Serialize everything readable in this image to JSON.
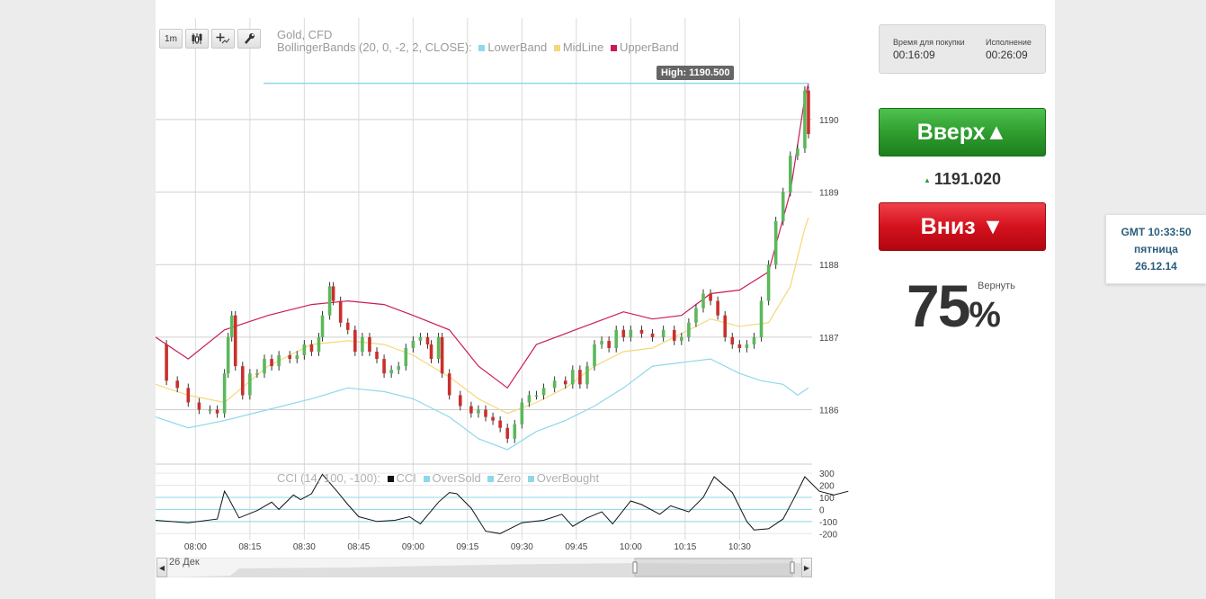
{
  "toolbar": {
    "interval_label": "1m",
    "buttons": [
      "candles-icon",
      "crosshair-icon",
      "wrench-icon"
    ]
  },
  "chart": {
    "instrument": "Gold, CFD",
    "indicator": "BollingerBands (20, 0, -2, 2, CLOSE):",
    "legend": [
      {
        "name": "LowerBand",
        "color": "#8fd8ea"
      },
      {
        "name": "MidLine",
        "color": "#f5d77a"
      },
      {
        "name": "UpperBand",
        "color": "#cc1a55"
      }
    ],
    "high_label": "High: 1190.500",
    "cci_title": "CCI (14, 100, -100):",
    "cci_legend": [
      {
        "name": "CCI",
        "color": "#111111"
      },
      {
        "name": "OverSold",
        "color": "#8fd8ea"
      },
      {
        "name": "Zero",
        "color": "#8fd8ea"
      },
      {
        "name": "OverBought",
        "color": "#8fd8ea"
      }
    ],
    "nav_date": "26 Дек"
  },
  "chart_data": {
    "type": "candlestick",
    "y_ticks": [
      "1190",
      "1189",
      "1188",
      "1187",
      "1186"
    ],
    "y_values": [
      1190,
      1189,
      1188,
      1187,
      1186
    ],
    "ylim": [
      1185.3,
      1191.4
    ],
    "x_ticks": [
      "08:00",
      "08:15",
      "08:30",
      "08:45",
      "09:00",
      "09:15",
      "09:30",
      "09:45",
      "10:00",
      "10:15",
      "10:30"
    ],
    "x_tick_minutes": [
      480,
      495,
      510,
      525,
      540,
      555,
      570,
      585,
      600,
      615,
      630
    ],
    "xlim_minutes": [
      469,
      650
    ],
    "close_series": [
      [
        469,
        1186.9
      ],
      [
        472,
        1186.4
      ],
      [
        475,
        1186.3
      ],
      [
        478,
        1186.1
      ],
      [
        481,
        1186.0
      ],
      [
        484,
        1186.0
      ],
      [
        486,
        1185.95
      ],
      [
        488,
        1186.5
      ],
      [
        489,
        1187.0
      ],
      [
        490,
        1187.3
      ],
      [
        491,
        1186.6
      ],
      [
        493,
        1186.2
      ],
      [
        495,
        1186.5
      ],
      [
        497,
        1186.5
      ],
      [
        499,
        1186.7
      ],
      [
        501,
        1186.6
      ],
      [
        503,
        1186.75
      ],
      [
        506,
        1186.7
      ],
      [
        508,
        1186.75
      ],
      [
        510,
        1186.9
      ],
      [
        512,
        1186.8
      ],
      [
        514,
        1187.0
      ],
      [
        515,
        1187.3
      ],
      [
        517,
        1187.7
      ],
      [
        518,
        1187.5
      ],
      [
        520,
        1187.2
      ],
      [
        522,
        1187.1
      ],
      [
        524,
        1186.8
      ],
      [
        526,
        1187.0
      ],
      [
        528,
        1186.8
      ],
      [
        530,
        1186.7
      ],
      [
        532,
        1186.5
      ],
      [
        534,
        1186.55
      ],
      [
        536,
        1186.6
      ],
      [
        538,
        1186.85
      ],
      [
        540,
        1186.95
      ],
      [
        542,
        1187.0
      ],
      [
        544,
        1186.9
      ],
      [
        545,
        1186.7
      ],
      [
        547,
        1187.0
      ],
      [
        548,
        1186.5
      ],
      [
        550,
        1186.2
      ],
      [
        553,
        1186.05
      ],
      [
        556,
        1185.95
      ],
      [
        558,
        1186.0
      ],
      [
        560,
        1185.9
      ],
      [
        562,
        1185.85
      ],
      [
        564,
        1185.75
      ],
      [
        566,
        1185.6
      ],
      [
        568,
        1185.8
      ],
      [
        570,
        1186.1
      ],
      [
        572,
        1186.2
      ],
      [
        574,
        1186.2
      ],
      [
        576,
        1186.3
      ],
      [
        579,
        1186.4
      ],
      [
        582,
        1186.35
      ],
      [
        584,
        1186.55
      ],
      [
        586,
        1186.35
      ],
      [
        588,
        1186.6
      ],
      [
        590,
        1186.9
      ],
      [
        592,
        1186.95
      ],
      [
        594,
        1186.85
      ],
      [
        596,
        1187.1
      ],
      [
        598,
        1187.0
      ],
      [
        600,
        1187.1
      ],
      [
        603,
        1187.05
      ],
      [
        606,
        1187.0
      ],
      [
        609,
        1187.1
      ],
      [
        612,
        1186.95
      ],
      [
        614,
        1187.0
      ],
      [
        616,
        1187.2
      ],
      [
        618,
        1187.4
      ],
      [
        620,
        1187.6
      ],
      [
        622,
        1187.5
      ],
      [
        624,
        1187.3
      ],
      [
        626,
        1187.0
      ],
      [
        628,
        1186.9
      ],
      [
        630,
        1186.85
      ],
      [
        632,
        1186.9
      ],
      [
        634,
        1187.0
      ],
      [
        636,
        1187.5
      ],
      [
        638,
        1188.0
      ],
      [
        640,
        1188.6
      ],
      [
        642,
        1189.0
      ],
      [
        644,
        1189.5
      ],
      [
        646,
        1189.6
      ],
      [
        648,
        1190.4
      ],
      [
        649,
        1189.8
      ]
    ],
    "high": 1190.5,
    "upper_band": [
      [
        469,
        1187.0
      ],
      [
        478,
        1186.7
      ],
      [
        488,
        1187.1
      ],
      [
        500,
        1187.3
      ],
      [
        512,
        1187.45
      ],
      [
        522,
        1187.5
      ],
      [
        532,
        1187.45
      ],
      [
        540,
        1187.3
      ],
      [
        550,
        1187.1
      ],
      [
        558,
        1186.6
      ],
      [
        566,
        1186.3
      ],
      [
        574,
        1186.9
      ],
      [
        582,
        1187.05
      ],
      [
        590,
        1187.2
      ],
      [
        598,
        1187.35
      ],
      [
        606,
        1187.25
      ],
      [
        614,
        1187.3
      ],
      [
        622,
        1187.6
      ],
      [
        630,
        1187.65
      ],
      [
        638,
        1187.9
      ],
      [
        644,
        1189.0
      ],
      [
        648,
        1190.3
      ],
      [
        649,
        1190.5
      ]
    ],
    "mid_line": [
      [
        469,
        1186.35
      ],
      [
        478,
        1186.2
      ],
      [
        488,
        1186.1
      ],
      [
        500,
        1186.6
      ],
      [
        512,
        1186.9
      ],
      [
        522,
        1186.95
      ],
      [
        532,
        1186.9
      ],
      [
        540,
        1186.75
      ],
      [
        550,
        1186.45
      ],
      [
        558,
        1186.15
      ],
      [
        566,
        1185.95
      ],
      [
        574,
        1186.1
      ],
      [
        582,
        1186.3
      ],
      [
        590,
        1186.6
      ],
      [
        598,
        1186.8
      ],
      [
        606,
        1186.85
      ],
      [
        614,
        1187.05
      ],
      [
        622,
        1187.25
      ],
      [
        630,
        1187.15
      ],
      [
        638,
        1187.2
      ],
      [
        644,
        1187.7
      ],
      [
        648,
        1188.5
      ],
      [
        649,
        1188.65
      ]
    ],
    "lower_band": [
      [
        469,
        1185.9
      ],
      [
        478,
        1185.75
      ],
      [
        488,
        1185.85
      ],
      [
        500,
        1186.0
      ],
      [
        512,
        1186.15
      ],
      [
        522,
        1186.3
      ],
      [
        532,
        1186.25
      ],
      [
        540,
        1186.15
      ],
      [
        550,
        1185.9
      ],
      [
        558,
        1185.6
      ],
      [
        566,
        1185.45
      ],
      [
        574,
        1185.7
      ],
      [
        582,
        1185.85
      ],
      [
        590,
        1186.05
      ],
      [
        598,
        1186.3
      ],
      [
        606,
        1186.6
      ],
      [
        614,
        1186.65
      ],
      [
        622,
        1186.7
      ],
      [
        630,
        1186.5
      ],
      [
        636,
        1186.4
      ],
      [
        642,
        1186.35
      ],
      [
        646,
        1186.2
      ],
      [
        649,
        1186.3
      ]
    ],
    "cci_y_ticks": [
      "300",
      "200",
      "100",
      "0",
      "-100",
      "-200"
    ],
    "cci_y_values": [
      300,
      200,
      100,
      0,
      -100,
      -200
    ],
    "cci_ylim": [
      -250,
      360
    ],
    "cci_levels": [
      -100,
      0,
      100
    ],
    "cci_series": [
      [
        469,
        -90
      ],
      [
        478,
        -110
      ],
      [
        486,
        -80
      ],
      [
        488,
        150
      ],
      [
        489,
        100
      ],
      [
        492,
        -70
      ],
      [
        497,
        -10
      ],
      [
        501,
        60
      ],
      [
        503,
        0
      ],
      [
        507,
        120
      ],
      [
        509,
        80
      ],
      [
        512,
        130
      ],
      [
        515,
        290
      ],
      [
        519,
        150
      ],
      [
        522,
        40
      ],
      [
        525,
        -60
      ],
      [
        530,
        -100
      ],
      [
        535,
        -90
      ],
      [
        539,
        -60
      ],
      [
        542,
        -120
      ],
      [
        547,
        60
      ],
      [
        550,
        140
      ],
      [
        552,
        130
      ],
      [
        556,
        10
      ],
      [
        560,
        -180
      ],
      [
        564,
        -200
      ],
      [
        570,
        -110
      ],
      [
        576,
        -90
      ],
      [
        581,
        -40
      ],
      [
        584,
        -140
      ],
      [
        588,
        -70
      ],
      [
        592,
        -20
      ],
      [
        595,
        -120
      ],
      [
        600,
        70
      ],
      [
        603,
        40
      ],
      [
        608,
        -40
      ],
      [
        611,
        30
      ],
      [
        616,
        -20
      ],
      [
        620,
        100
      ],
      [
        623,
        270
      ],
      [
        628,
        140
      ],
      [
        632,
        -100
      ],
      [
        634,
        -170
      ],
      [
        638,
        -160
      ],
      [
        642,
        -80
      ],
      [
        645,
        90
      ],
      [
        648,
        270
      ],
      [
        652,
        150
      ],
      [
        656,
        120
      ],
      [
        660,
        150
      ]
    ]
  },
  "trade": {
    "purchase_time_label": "Время для покупки",
    "purchase_time": "00:16:09",
    "expiry_label": "Исполнение",
    "expiry_time": "00:26:09",
    "up_label": "Вверх▲",
    "current_price": "1191.020",
    "down_label": "Вниз ▼",
    "payout": "75",
    "payout_symbol": "%",
    "return_label": "Вернуть",
    "up_color": "#2f9e2f",
    "down_color": "#d4121d"
  },
  "clock": {
    "time": "GMT 10:33:50",
    "weekday": "пятница",
    "date": "26.12.14"
  }
}
